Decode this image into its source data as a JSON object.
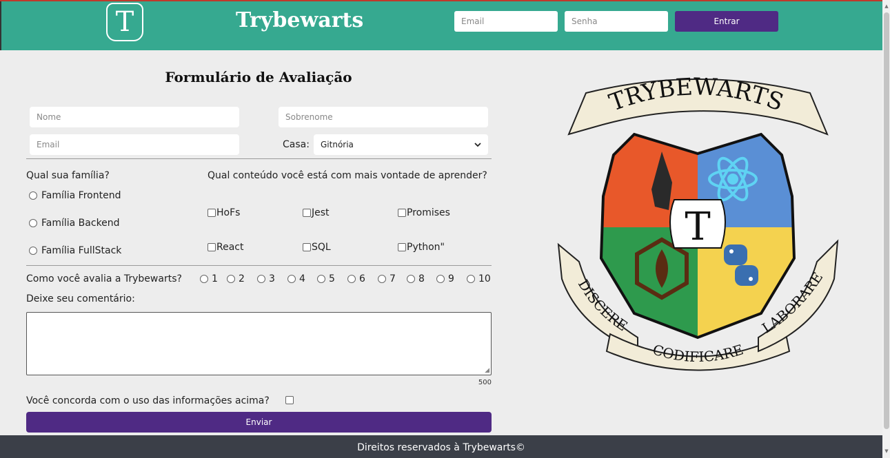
{
  "header": {
    "logo_letter": "T",
    "brand": "Trybewarts",
    "email_placeholder": "Email",
    "password_placeholder": "Senha",
    "login_label": "Entrar",
    "accent": "#36a990",
    "button_color": "#4f2a84"
  },
  "form": {
    "title": "Formulário de Avaliação",
    "nome_placeholder": "Nome",
    "sobrenome_placeholder": "Sobrenome",
    "email_placeholder": "Email",
    "casa_label": "Casa:",
    "casa_selected": "Gitnória",
    "familia_question": "Qual sua família?",
    "familias": [
      "Família Frontend",
      "Família Backend",
      "Família FullStack"
    ],
    "conteudo_question": "Qual conteúdo você está com mais vontade de aprender?",
    "conteudos": [
      "HoFs",
      "Jest",
      "Promises",
      "React",
      "SQL",
      "Python\""
    ],
    "rating_question": "Como você avalia a Trybewarts?",
    "ratings": [
      "1",
      "2",
      "3",
      "4",
      "5",
      "6",
      "7",
      "8",
      "9",
      "10"
    ],
    "comment_label": "Deixe seu comentário:",
    "char_counter": "500",
    "agree_question": "Você concorda com o uso das informações acima?",
    "submit_label": "Enviar"
  },
  "crest": {
    "top_banner": "TRYBEWARTS",
    "center_letter": "T",
    "motto_left": "DISCERE",
    "motto_center": "CODIFICARE",
    "motto_right": "LABORARE",
    "quadrant_colors": [
      "#e8582a",
      "#5a8fd5",
      "#2e9a4d",
      "#f4d24f"
    ]
  },
  "footer": {
    "text": "Direitos reservados à Trybewarts©"
  }
}
